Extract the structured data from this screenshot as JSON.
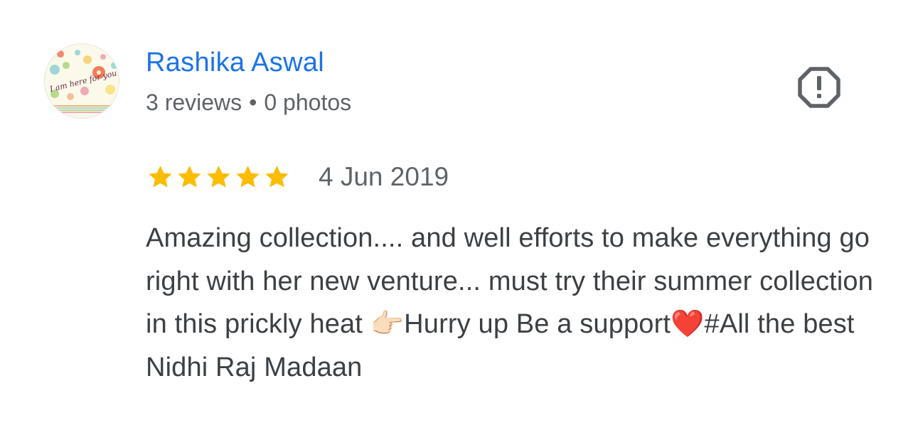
{
  "review": {
    "author": {
      "name": "Rashika Aswal",
      "reviews_count": "3 reviews",
      "separator": "•",
      "photos_count": "0 photos",
      "avatar_icon": "floral-avatar-image",
      "avatar_text": "I am here for you"
    },
    "report_icon": "report-octagon-icon",
    "rating": {
      "value": 5,
      "max": 5,
      "star_color": "#fbbc04"
    },
    "date": "4 Jun 2019",
    "text": "Amazing collection.... and well efforts to make everything go right with her new venture... must try their summer collection in this prickly heat 👉🏻Hurry up Be a support❤️#All the best Nidhi Raj Madaan"
  },
  "colors": {
    "author_name": "#1a73e8",
    "meta_text": "#5f6368",
    "body_text": "#3c4043",
    "icon": "#5f6368"
  }
}
